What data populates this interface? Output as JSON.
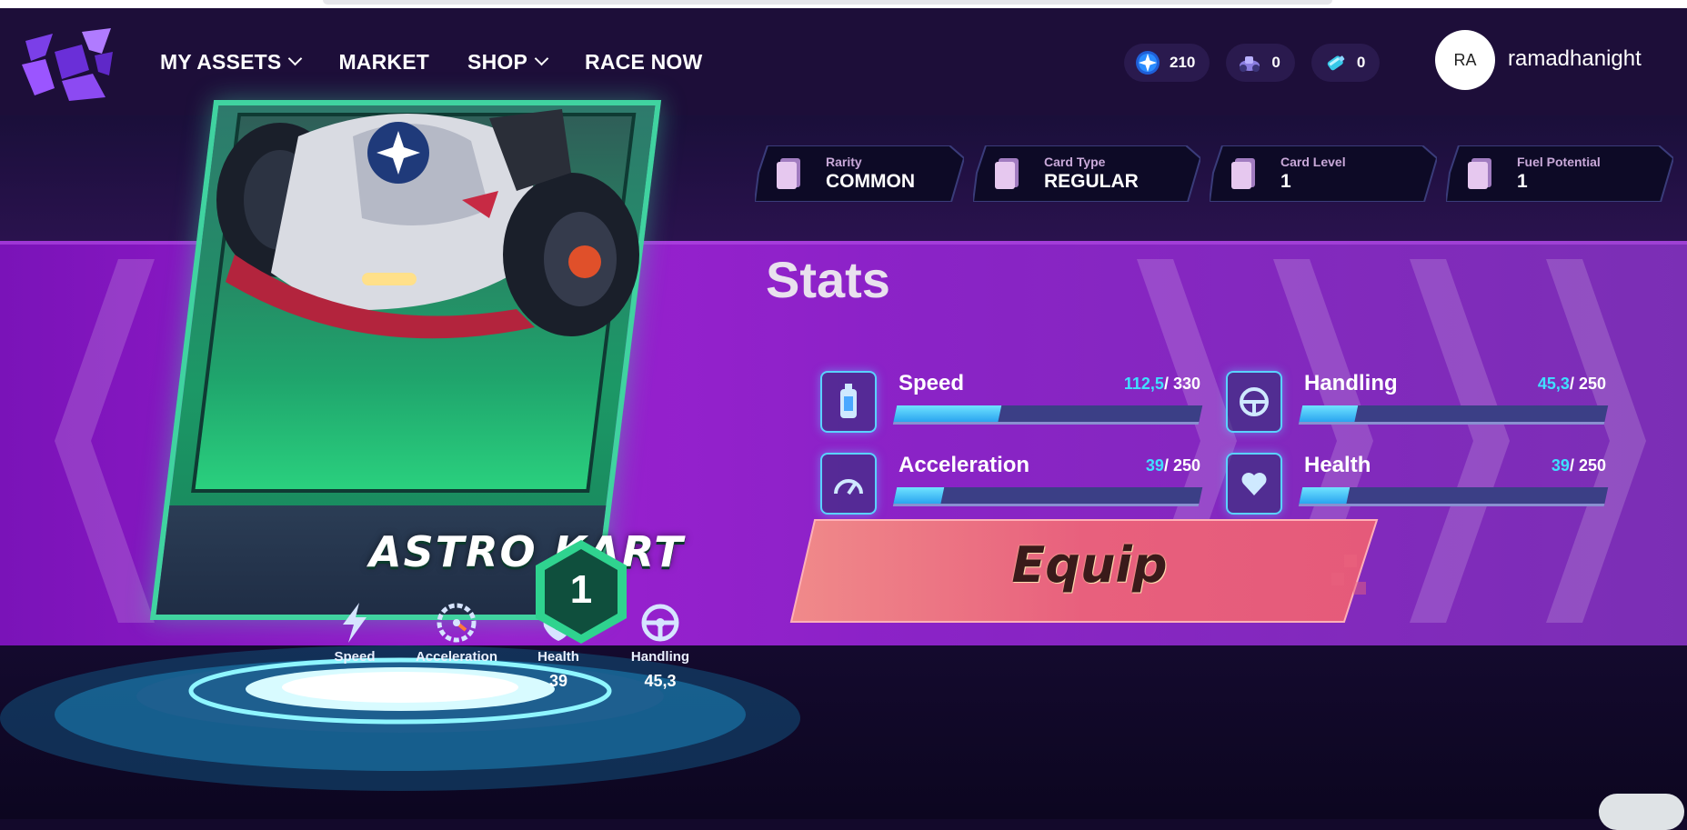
{
  "header": {
    "nav": [
      {
        "label": "MY ASSETS",
        "dropdown": true
      },
      {
        "label": "MARKET",
        "dropdown": false
      },
      {
        "label": "SHOP",
        "dropdown": true
      },
      {
        "label": "RACE NOW",
        "dropdown": false
      }
    ],
    "currencies": [
      {
        "icon": "star-coin-icon",
        "value": "210"
      },
      {
        "icon": "kart-token-icon",
        "value": "0"
      },
      {
        "icon": "fuel-canister-icon",
        "value": "0"
      }
    ],
    "user": {
      "initials": "RA",
      "name": "ramadhanight"
    }
  },
  "card": {
    "name": "ASTRO KART",
    "level": "1",
    "stats": [
      {
        "icon": "lightning-icon",
        "label": "Speed",
        "value": "112,5"
      },
      {
        "icon": "gauge-icon",
        "label": "Acceleration",
        "value": "39"
      },
      {
        "icon": "shield-plus-icon",
        "label": "Health",
        "value": "39"
      },
      {
        "icon": "steering-wheel-icon",
        "label": "Handling",
        "value": "45,3"
      }
    ]
  },
  "tags": [
    {
      "label": "Rarity",
      "value": "COMMON"
    },
    {
      "label": "Card Type",
      "value": "REGULAR"
    },
    {
      "label": "Card Level",
      "value": "1"
    },
    {
      "label": "Fuel Potential",
      "value": "1"
    }
  ],
  "stats_panel": {
    "title": "Stats",
    "stats": [
      {
        "name": "Speed",
        "icon": "nitro-bottle-icon",
        "current": "112,5",
        "max": "330",
        "fraction": 0.341
      },
      {
        "name": "Handling",
        "icon": "steering-wheel-icon",
        "current": "45,3",
        "max": "250",
        "fraction": 0.181
      },
      {
        "name": "Acceleration",
        "icon": "speedometer-icon",
        "current": "39",
        "max": "250",
        "fraction": 0.156
      },
      {
        "name": "Health",
        "icon": "heart-icon",
        "current": "39",
        "max": "250",
        "fraction": 0.156
      }
    ]
  },
  "equip_label": "Equip",
  "colors": {
    "accent_cyan": "#3fe0ff",
    "card_green": "#40d3a0",
    "header_bg": "#1d0e39",
    "equip_pink": "#e0507f"
  }
}
